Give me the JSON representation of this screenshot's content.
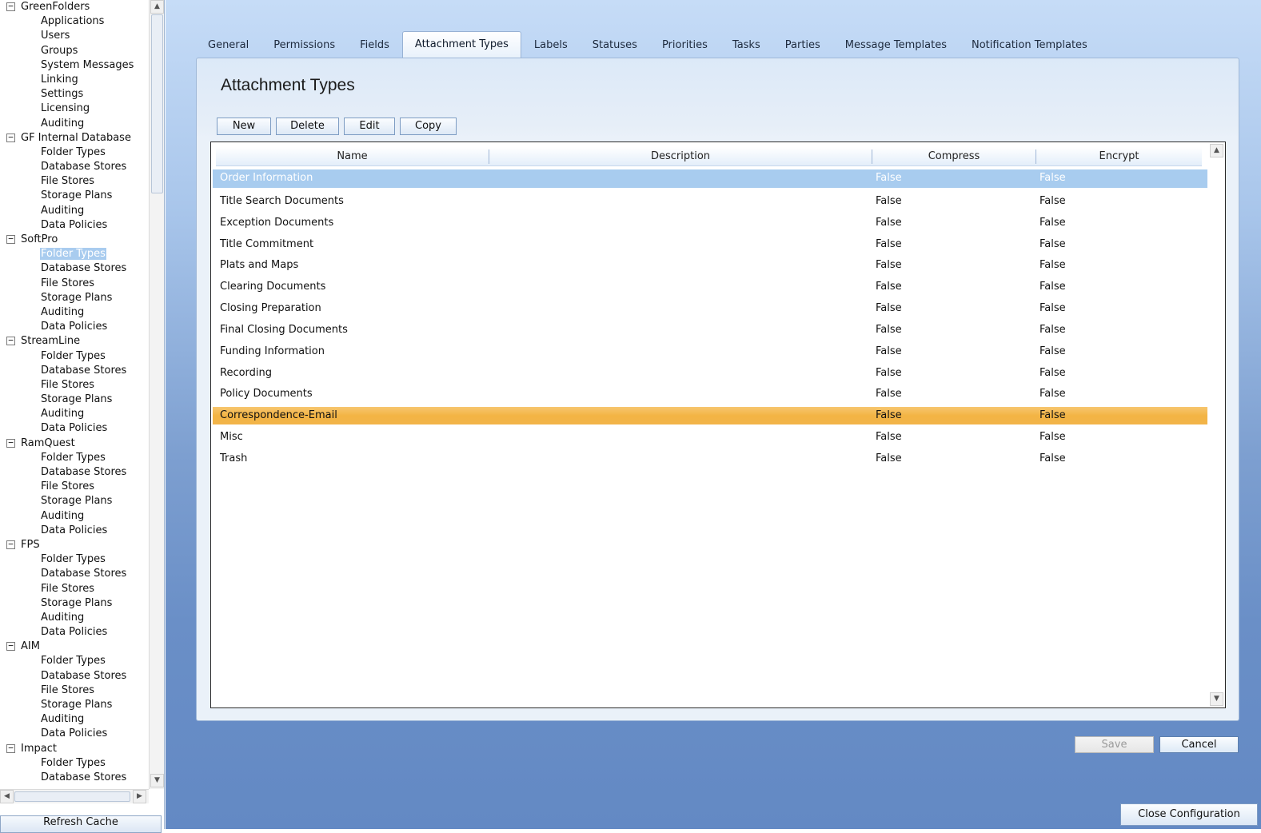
{
  "tree": {
    "groups": [
      {
        "label": "GreenFolders",
        "toggle": "−",
        "items": [
          "Applications",
          "Users",
          "Groups",
          "System Messages",
          "Linking",
          "Settings",
          "Licensing",
          "Auditing"
        ]
      },
      {
        "label": "GF Internal Database",
        "toggle": "−",
        "items": [
          "Folder Types",
          "Database Stores",
          "File Stores",
          "Storage Plans",
          "Auditing",
          "Data Policies"
        ]
      },
      {
        "label": "SoftPro",
        "toggle": "−",
        "items": [
          "Folder Types",
          "Database Stores",
          "File Stores",
          "Storage Plans",
          "Auditing",
          "Data Policies"
        ],
        "selected_index": 0
      },
      {
        "label": "StreamLine",
        "toggle": "−",
        "items": [
          "Folder Types",
          "Database Stores",
          "File Stores",
          "Storage Plans",
          "Auditing",
          "Data Policies"
        ]
      },
      {
        "label": "RamQuest",
        "toggle": "−",
        "items": [
          "Folder Types",
          "Database Stores",
          "File Stores",
          "Storage Plans",
          "Auditing",
          "Data Policies"
        ]
      },
      {
        "label": "FPS",
        "toggle": "−",
        "items": [
          "Folder Types",
          "Database Stores",
          "File Stores",
          "Storage Plans",
          "Auditing",
          "Data Policies"
        ]
      },
      {
        "label": "AIM",
        "toggle": "−",
        "items": [
          "Folder Types",
          "Database Stores",
          "File Stores",
          "Storage Plans",
          "Auditing",
          "Data Policies"
        ]
      },
      {
        "label": "Impact",
        "toggle": "−",
        "items": [
          "Folder Types",
          "Database Stores"
        ]
      }
    ],
    "scroll_up_icon": "▲",
    "scroll_down_icon": "▼",
    "scroll_left_icon": "◀",
    "scroll_right_icon": "▶",
    "refresh_label": "Refresh Cache"
  },
  "tabs": [
    {
      "label": "General"
    },
    {
      "label": "Permissions"
    },
    {
      "label": "Fields"
    },
    {
      "label": "Attachment Types",
      "active": true
    },
    {
      "label": "Labels"
    },
    {
      "label": "Statuses"
    },
    {
      "label": "Priorities"
    },
    {
      "label": "Tasks"
    },
    {
      "label": "Parties"
    },
    {
      "label": "Message Templates"
    },
    {
      "label": "Notification Templates"
    }
  ],
  "page": {
    "title": "Attachment Types"
  },
  "toolbar": {
    "new_label": "New",
    "delete_label": "Delete",
    "edit_label": "Edit",
    "copy_label": "Copy"
  },
  "grid": {
    "columns": [
      "Name",
      "Description",
      "Compress",
      "Encrypt"
    ],
    "rows": [
      {
        "name": "Order Information",
        "description": "",
        "compress": "False",
        "encrypt": "False",
        "state": "selected"
      },
      {
        "name": "Title Search Documents",
        "description": "",
        "compress": "False",
        "encrypt": "False"
      },
      {
        "name": "Exception Documents",
        "description": "",
        "compress": "False",
        "encrypt": "False"
      },
      {
        "name": "Title Commitment",
        "description": "",
        "compress": "False",
        "encrypt": "False"
      },
      {
        "name": "Plats and Maps",
        "description": "",
        "compress": "False",
        "encrypt": "False"
      },
      {
        "name": "Clearing Documents",
        "description": "",
        "compress": "False",
        "encrypt": "False"
      },
      {
        "name": "Closing Preparation",
        "description": "",
        "compress": "False",
        "encrypt": "False"
      },
      {
        "name": "Final Closing Documents",
        "description": "",
        "compress": "False",
        "encrypt": "False"
      },
      {
        "name": "Funding Information",
        "description": "",
        "compress": "False",
        "encrypt": "False"
      },
      {
        "name": "Recording",
        "description": "",
        "compress": "False",
        "encrypt": "False"
      },
      {
        "name": "Policy Documents",
        "description": "",
        "compress": "False",
        "encrypt": "False"
      },
      {
        "name": "Correspondence-Email",
        "description": "",
        "compress": "False",
        "encrypt": "False",
        "state": "highlight"
      },
      {
        "name": "Misc",
        "description": "",
        "compress": "False",
        "encrypt": "False"
      },
      {
        "name": "Trash",
        "description": "",
        "compress": "False",
        "encrypt": "False"
      }
    ],
    "scroll_up_icon": "▲",
    "scroll_down_icon": "▼"
  },
  "actions": {
    "save_label": "Save",
    "cancel_label": "Cancel",
    "close_label": "Close Configuration"
  },
  "colors": {
    "selection": "#a8ccef",
    "highlight": "#f3b444",
    "background_top": "#c6dcf7",
    "background_bottom": "#6389c4"
  }
}
